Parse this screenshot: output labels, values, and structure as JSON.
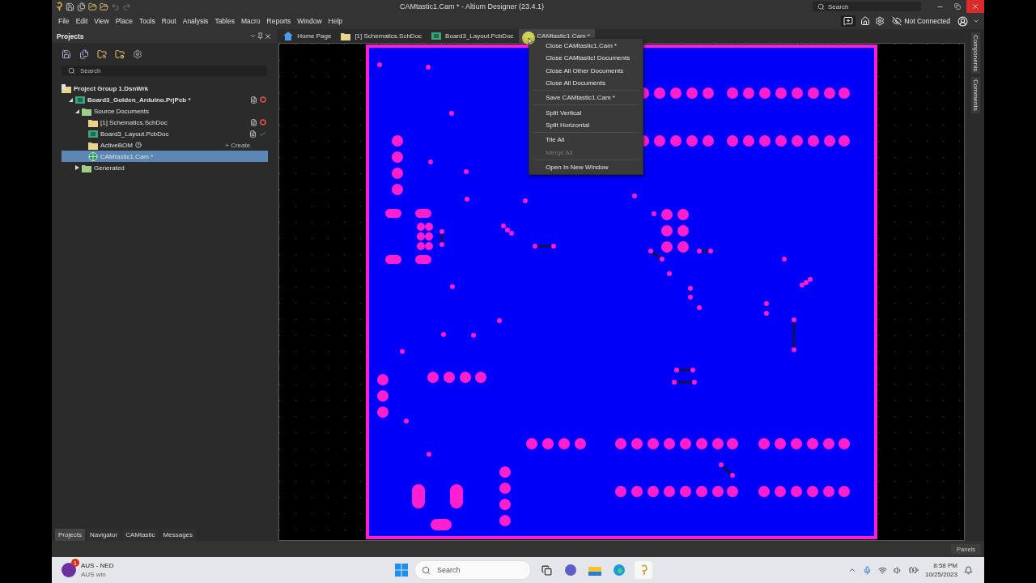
{
  "window": {
    "title": "CAMtastic1.Cam * - Altium Designer (23.4.1)",
    "search_placeholder": "Search"
  },
  "menu": [
    "File",
    "Edit",
    "View",
    "Place",
    "Tools",
    "Rout",
    "Analysis",
    "Tables",
    "Macro",
    "Reports",
    "Window",
    "Help"
  ],
  "toolbar_right": {
    "connection": "Not Connected"
  },
  "projects_panel": {
    "title": "Projects",
    "search": {
      "placeholder": "Search"
    },
    "tree": [
      {
        "label": "Project Group 1.DsnWrk",
        "kind": "group",
        "selected": false,
        "children": [
          {
            "label": "Board3_Golden_Arduino.PrjPcb *",
            "kind": "project",
            "expanded": true,
            "selected": false,
            "error": true,
            "children": [
              {
                "label": "Source Documents",
                "kind": "folder",
                "expanded": true,
                "selected": false,
                "children": [
                  {
                    "label": "[1] Schematics.SchDoc",
                    "kind": "sch",
                    "selected": false,
                    "error": true
                  },
                  {
                    "label": "Board3_Layout.PcbDoc",
                    "kind": "pcb",
                    "selected": false,
                    "verified": true
                  },
                  {
                    "label": "ActiveBOM",
                    "kind": "bom",
                    "selected": false,
                    "help": true,
                    "action": "+ Create"
                  },
                  {
                    "label": "CAMtastic1.Cam *",
                    "kind": "cam",
                    "selected": true
                  }
                ]
              },
              {
                "label": "Generated",
                "kind": "folder",
                "expanded": false,
                "selected": false
              }
            ]
          }
        ]
      }
    ],
    "bottom_tabs": [
      {
        "label": "Projects",
        "selected": true
      },
      {
        "label": "Navigator",
        "selected": false
      },
      {
        "label": "CAMtastic",
        "selected": false
      },
      {
        "label": "Messages",
        "selected": false
      }
    ]
  },
  "document_tabs": [
    {
      "label": "Home Page",
      "kind": "home",
      "selected": false
    },
    {
      "label": "[1] Schematics.SchDoc",
      "kind": "sch",
      "selected": false
    },
    {
      "label": "Board3_Layout.PcbDoc",
      "kind": "pcb",
      "selected": false
    },
    {
      "label": "CAMtastic1.Cam *",
      "kind": "cam",
      "selected": true
    }
  ],
  "context_menu": {
    "groups": [
      [
        {
          "label": "Close CAMtastic1.Cam *",
          "disabled": false
        },
        {
          "label": "Close CAMtastic! Documents",
          "disabled": false
        },
        {
          "label": "Close All Other Documents",
          "disabled": false
        },
        {
          "label": "Close All Documents",
          "disabled": false
        }
      ],
      [
        {
          "label": "Save CAMtastic1.Cam *",
          "disabled": false
        }
      ],
      [
        {
          "label": "Split Vertical",
          "disabled": false
        },
        {
          "label": "Split Horizontal",
          "disabled": false
        }
      ],
      [
        {
          "label": "Tile All",
          "disabled": false
        },
        {
          "label": "Merge All",
          "disabled": true
        }
      ],
      [
        {
          "label": "Open In New Window",
          "disabled": false
        }
      ]
    ]
  },
  "side_tabs": [
    "Components",
    "Comments"
  ],
  "status_bar": {
    "panels_button": "Panels"
  },
  "taskbar": {
    "weather": {
      "title": "AUS - NED",
      "subtitle": "AUS win",
      "badge": "1"
    },
    "search": {
      "placeholder": "Search"
    },
    "time": "8:58 PM",
    "date": "10/25/2023"
  }
}
